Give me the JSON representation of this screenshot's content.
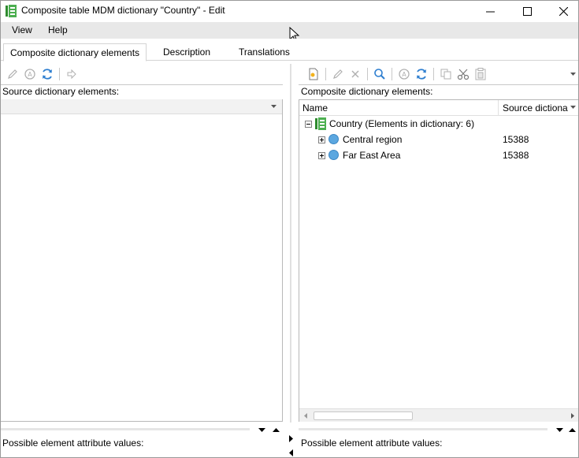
{
  "window": {
    "title": "Composite table MDM dictionary \"Country\" - Edit"
  },
  "menu": {
    "items": [
      "View",
      "Help"
    ]
  },
  "tabs": [
    {
      "label": "Composite dictionary elements",
      "active": true
    },
    {
      "label": "Description",
      "active": false
    },
    {
      "label": "Translations",
      "active": false
    }
  ],
  "left": {
    "label": "Source dictionary elements:",
    "bottom_label": "Possible element attribute values:"
  },
  "right": {
    "label": "Composite dictionary elements:",
    "columns": [
      "Name",
      "Source dictiona"
    ],
    "root": {
      "label": "Country (Elements in dictionary: 6)"
    },
    "rows": [
      {
        "name": "Central region",
        "source": "15388"
      },
      {
        "name": "Far East Area",
        "source": "15388"
      }
    ],
    "bottom_label": "Possible element attribute values:"
  },
  "colors": {
    "menubar": "#e8e8e8",
    "globe": "#5ba7e0",
    "dictionary_icon": "#3a9a3a"
  }
}
